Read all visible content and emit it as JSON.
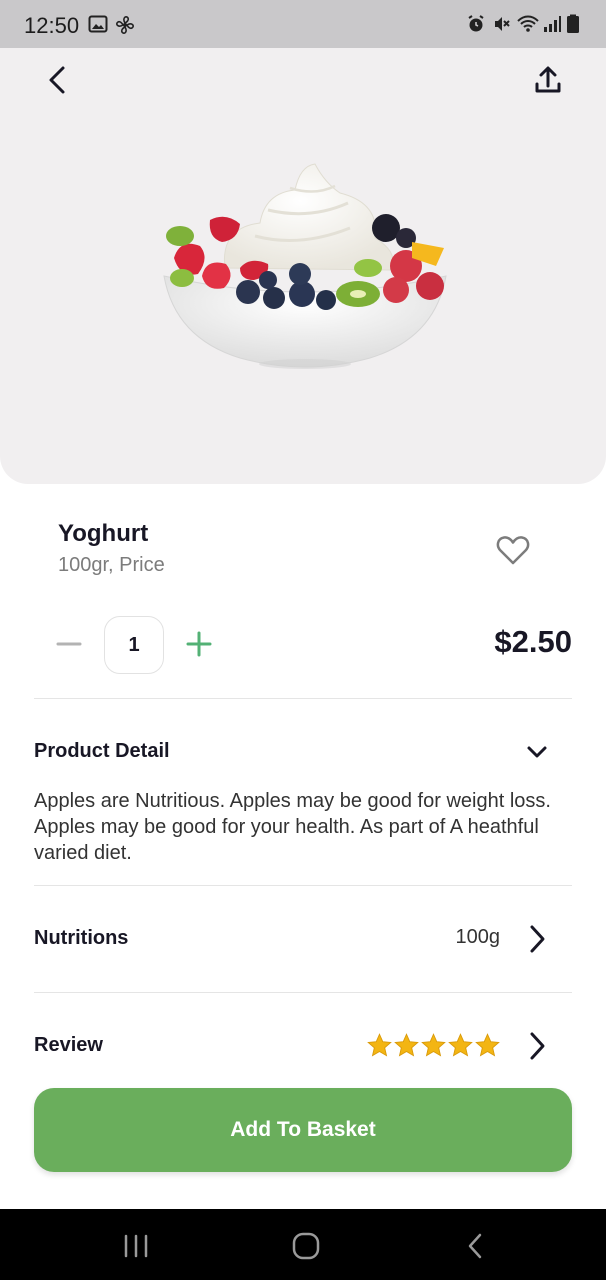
{
  "status_bar": {
    "time": "12:50",
    "left_icons": [
      "image-icon",
      "fan-icon"
    ],
    "right_icons": [
      "alarm-icon",
      "mute-icon",
      "wifi-icon",
      "signal-icon",
      "battery-icon"
    ]
  },
  "header": {
    "back_icon": "chevron-left-icon",
    "share_icon": "share-upload-icon"
  },
  "product": {
    "name": "Yoghurt",
    "subtitle": "100gr, Price",
    "quantity": "1",
    "price": "$2.50",
    "favorite_icon": "heart-outline-icon"
  },
  "detail": {
    "title": "Product Detail",
    "text": "Apples are Nutritious. Apples may be good for weight loss. Apples may be good for your health. As part of A heathful varied diet."
  },
  "nutritions": {
    "label": "Nutritions",
    "value": "100g"
  },
  "review": {
    "label": "Review",
    "rating": 5,
    "max": 5
  },
  "cta": {
    "label": "Add To Basket"
  },
  "colors": {
    "accent": "#6aae5c",
    "plus": "#53b175",
    "star": "#f3b513"
  }
}
